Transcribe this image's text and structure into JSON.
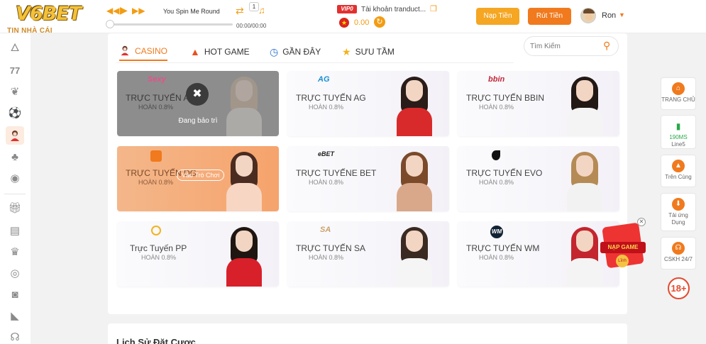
{
  "header": {
    "logo": "V6BET",
    "tagline": "TIN NHÀ CÁI",
    "player": {
      "song": "You Spin Me Round",
      "time": "00:00/00:00",
      "queue": "1",
      "progress": 0
    },
    "account": {
      "vip": "VIP0",
      "label": "Tài khoản tranduct...",
      "balance": "0.00"
    },
    "deposit_label": "Nạp Tiền",
    "withdraw_label": "Rút Tiền",
    "username": "Ron"
  },
  "sidebar": {
    "icons": [
      "fire-icon",
      "lottery-icon",
      "cockfight-icon",
      "soccer-icon",
      "casino-icon",
      "cards-icon",
      "fish-icon",
      "gift-icon",
      "calendar-icon",
      "vip-icon",
      "medal-icon",
      "camera-icon",
      "megaphone-icon",
      "headset-icon"
    ]
  },
  "tabs": [
    {
      "label": "CASINO",
      "icon": "dealer-icon",
      "selected": true
    },
    {
      "label": "HOT GAME",
      "icon": "flame-icon"
    },
    {
      "label": "GẦN ĐÂY",
      "icon": "clock-icon"
    },
    {
      "label": "SƯU TẦM",
      "icon": "star-icon"
    }
  ],
  "search": {
    "placeholder": "Tìm Kiếm"
  },
  "cards": [
    {
      "title": "TRỰC TUYẾN AE",
      "rate": "HOÀN 0.8%",
      "brand": "Sexy",
      "state": "maintenance",
      "overlay": "Đang bảo trì"
    },
    {
      "title": "TRỰC TUYẾN AG",
      "rate": "HOÀN 0.8%",
      "brand": "AG"
    },
    {
      "title": "TRỰC TUYẾN BBIN",
      "rate": "HOÀN 0.8%",
      "brand": "bbin"
    },
    {
      "title": "TRỰC TUYẾN DG",
      "rate": "HOÀN 0.8%",
      "brand": "",
      "state": "hover",
      "overlay": "Vào Trò Chơi"
    },
    {
      "title": "TRỰC TUYẾNE BET",
      "rate": "HOÀN 0.8%",
      "brand": "eBET"
    },
    {
      "title": "TRỰC TUYẾN EVO",
      "rate": "HOÀN 0.8%",
      "brand": ""
    },
    {
      "title": "Trực Tuyến PP",
      "rate": "HOÀN 0.8%",
      "brand": ""
    },
    {
      "title": "TRỰC TUYẾN SA",
      "rate": "HOÀN 0.8%",
      "brand": "SA"
    },
    {
      "title": "TRỰC TUYẾN WM",
      "rate": "HOÀN 0.8%",
      "brand": "WM"
    }
  ],
  "bottom": {
    "title": "Lịch Sử Đặt Cược"
  },
  "right_sidebar": {
    "home": "TRANG CHỦ",
    "line_ms": "190MS",
    "line": "Line5",
    "top": "Trên Cùng",
    "app": "Tải ứng Dụng",
    "support": "CSKH 24/7",
    "age": "18+"
  },
  "promo": {
    "label": "NẠP GAME",
    "badge": "Lĩnh"
  },
  "colors": {
    "accent": "#f07a1d",
    "deposit": "#f5a623",
    "withdraw": "#f07a1d"
  }
}
